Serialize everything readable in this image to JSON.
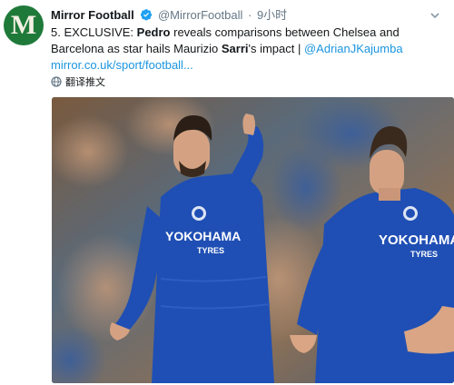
{
  "account": {
    "name": "Mirror Football",
    "handle": "@MirrorFootball",
    "separator": "·",
    "time": "9小时",
    "avatar_letter": "M"
  },
  "tweet": {
    "prefix": "5. EXCLUSIVE: ",
    "bold1": "Pedro",
    "mid": " reveals comparisons between Chelsea and Barcelona as star hails Maurizio ",
    "bold2": "Sarri",
    "suffix": "'s impact | ",
    "mention": "@AdrianJKajumba",
    "link": "mirror.co.uk/sport/football..."
  },
  "translate_label": "翻译推文",
  "image": {
    "shirt_sponsor_left": "YOKOHAMA",
    "shirt_sponsor_left_sub": "TYRES",
    "shirt_sponsor_right": "YOKOHAMA",
    "shirt_sponsor_right_sub": "TYRES"
  },
  "colors": {
    "link": "#1b95e0",
    "secondary_text": "#657786",
    "chelsea_blue": "#1f4fb4",
    "avatar_green": "#1f7a3a"
  },
  "icons": [
    "verified-badge-icon",
    "chevron-down-icon",
    "globe-icon"
  ]
}
